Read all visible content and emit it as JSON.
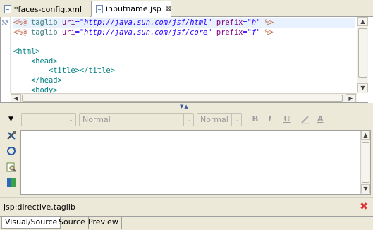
{
  "tabs": [
    {
      "label": "*faces-config.xml",
      "active": false
    },
    {
      "label": "inputname.jsp",
      "active": true,
      "close": "⊠"
    }
  ],
  "source": {
    "lines": [
      {
        "parts": [
          [
            "d",
            "<%@ "
          ],
          [
            "kw",
            "taglib "
          ],
          [
            "at",
            "uri"
          ],
          [
            "",
            ""
          ],
          [
            "av",
            "=\"http://java.sun.com/jsf/html\""
          ],
          [
            "",
            " "
          ],
          [
            "at",
            "prefix"
          ],
          [
            "av",
            "=\"h\""
          ],
          [
            "",
            " "
          ],
          [
            "d",
            "%>"
          ]
        ],
        "highlight": true
      },
      {
        "parts": [
          [
            "d",
            "<%@ "
          ],
          [
            "kw",
            "taglib "
          ],
          [
            "at",
            "uri"
          ],
          [
            "av",
            "=\"http://java.sun.com/jsf/core\""
          ],
          [
            "",
            " "
          ],
          [
            "at",
            "prefix"
          ],
          [
            "av",
            "=\"f\""
          ],
          [
            "",
            " "
          ],
          [
            "d",
            "%>"
          ]
        ]
      },
      {
        "parts": [
          [
            "",
            ""
          ]
        ]
      },
      {
        "parts": [
          [
            "tg",
            "<html>"
          ]
        ]
      },
      {
        "parts": [
          [
            "",
            "    "
          ],
          [
            "tg",
            "<head>"
          ]
        ]
      },
      {
        "parts": [
          [
            "",
            "        "
          ],
          [
            "tg",
            "<title></title>"
          ]
        ]
      },
      {
        "parts": [
          [
            "",
            "    "
          ],
          [
            "tg",
            "</head>"
          ]
        ]
      },
      {
        "parts": [
          [
            "",
            "    "
          ],
          [
            "tg",
            "<body>"
          ]
        ]
      }
    ]
  },
  "toolbar": {
    "font_family": "",
    "style": "Normal",
    "size": "Normal",
    "bold": "B",
    "italic": "I",
    "underline": "U",
    "text_color": "A"
  },
  "status": {
    "path": "jsp:directive.taglib"
  },
  "bottom_tabs": [
    {
      "label": "Visual/Source",
      "active": true
    },
    {
      "label": "Source",
      "active": false
    },
    {
      "label": "Preview",
      "active": false
    }
  ],
  "colors": {
    "directive": "#bf5f3f",
    "tag": "#008080",
    "attribute": "#7f007f",
    "value": "#2a00ff",
    "error": "#e03030"
  }
}
